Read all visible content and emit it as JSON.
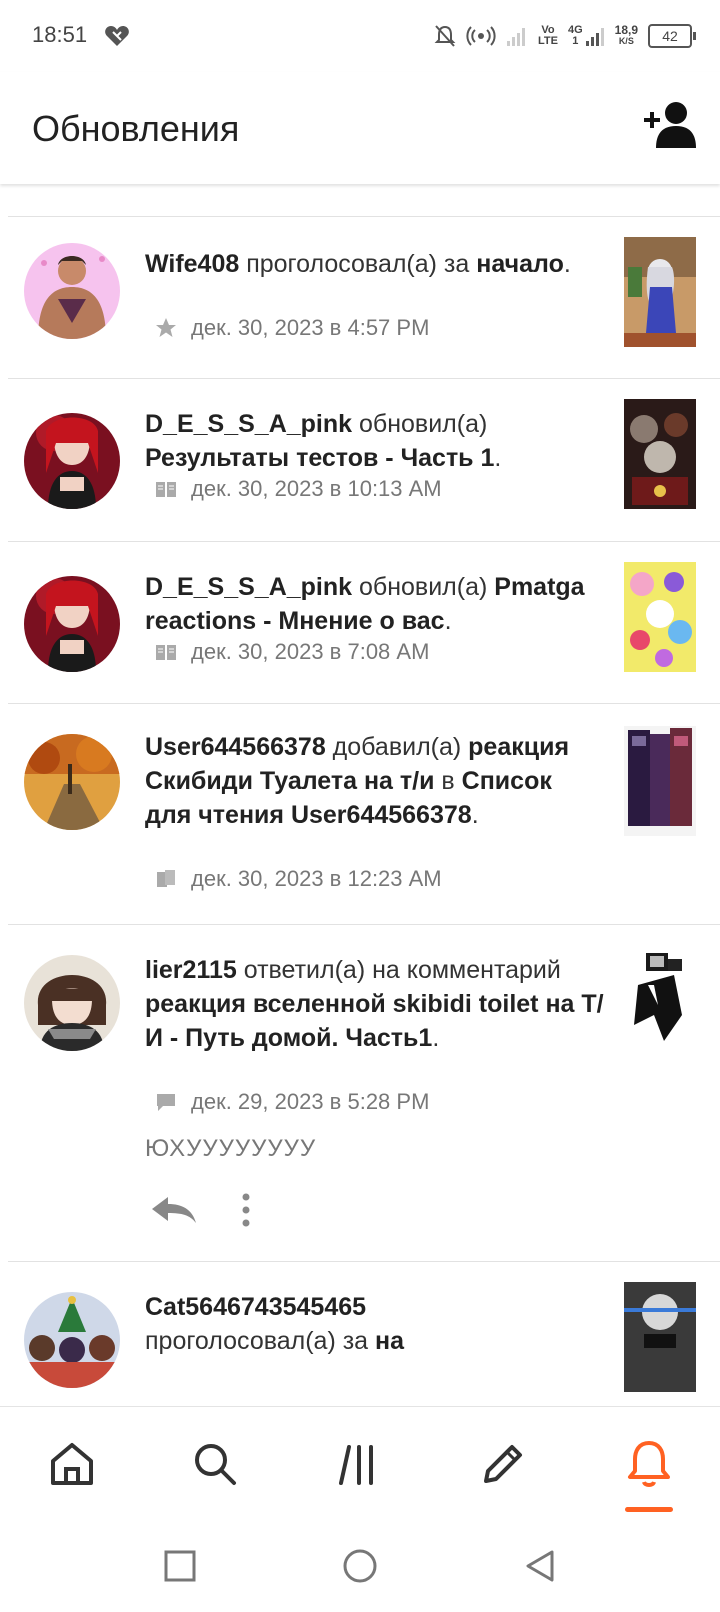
{
  "status_bar": {
    "time": "18:51",
    "vo": "Vo",
    "lte": "LTE",
    "network": "4G",
    "sim": "1",
    "speed_value": "18,9",
    "speed_unit": "K/S",
    "battery": "42"
  },
  "header": {
    "title": "Обновления"
  },
  "feed": [
    {
      "user": "Wife408",
      "parts": [
        {
          "t": " проголосовал(а) за ",
          "b": false
        },
        {
          "t": "начало",
          "b": true
        },
        {
          "t": ".",
          "b": false
        }
      ],
      "meta_icon": "star-icon",
      "timestamp": "дек. 30, 2023 в 4:57 PM"
    },
    {
      "user": "D_E_S_S_A_pink",
      "parts": [
        {
          "t": " обновил(а) ",
          "b": false
        },
        {
          "t": "Результаты тестов - Часть 1",
          "b": true
        },
        {
          "t": ".",
          "b": false
        }
      ],
      "meta_icon": "book-icon",
      "timestamp": "дек. 30, 2023 в 10:13 AM"
    },
    {
      "user": "D_E_S_S_A_pink",
      "parts": [
        {
          "t": " обновил(а) ",
          "b": false
        },
        {
          "t": "Pmatga reactions - Мнение о вас",
          "b": true
        },
        {
          "t": ".",
          "b": false
        }
      ],
      "meta_icon": "book-icon",
      "timestamp": "дек. 30, 2023 в 7:08 AM"
    },
    {
      "user": "User644566378",
      "parts": [
        {
          "t": " добавил(а) ",
          "b": false
        },
        {
          "t": "реакция Скибиди Туалета на т/и",
          "b": true
        },
        {
          "t": " в ",
          "b": false
        },
        {
          "t": "Список для чтения User644566378",
          "b": true
        },
        {
          "t": ".",
          "b": false
        }
      ],
      "meta_icon": "reading-list-icon",
      "timestamp": "дек. 30, 2023 в 12:23 AM"
    },
    {
      "user": "lier2115",
      "parts": [
        {
          "t": " ответил(а) на комментарий ",
          "b": false
        },
        {
          "t": "реакция вселенной skibidi toilet на Т/И - Путь домой. Часть1",
          "b": true
        },
        {
          "t": ".",
          "b": false
        }
      ],
      "meta_icon": "comment-icon",
      "timestamp": "дек. 29, 2023 в 5:28 PM",
      "comment": "ЮХУУУУУУУУ"
    },
    {
      "user": "Cat5646743545465",
      "parts": [
        {
          "t": " проголосовал(а) за ",
          "b": false
        },
        {
          "t": "на",
          "b": true
        }
      ]
    }
  ],
  "bottom_nav": {
    "items": [
      "home-icon",
      "search-icon",
      "library-icon",
      "write-icon",
      "notifications-icon"
    ],
    "active": "notifications-icon",
    "accent_color": "#ff6122"
  },
  "system_nav": [
    "recents-icon",
    "home-circle-icon",
    "back-icon"
  ]
}
